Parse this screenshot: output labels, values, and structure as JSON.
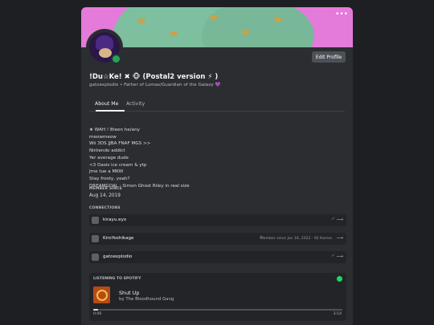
{
  "profile": {
    "display_name": "!Du☆Ke! ✖ 🐵 (Postal2 version ⚡ )",
    "subline": "gatoexplodio • Father of Lumas/Guardian of the Galaxy 💜",
    "edit_button": "Edit Profile",
    "status": "online",
    "banner_color": "#e47ad9",
    "status_color": "#23a559"
  },
  "tabs": [
    {
      "label": "About Me",
      "active": true
    },
    {
      "label": "Activity",
      "active": false
    }
  ],
  "bio_lines": "★ WAH ! 8teen he/any\nmeowmeow\nWii 3DS JJBA FNAF MGS >>\nNintendo addict\nYer average dude\n<3 Oasis ice cream & ytp\nJme tue a MKW\nStay frosty, yeah?\nDREAMGOAL : Simon Ghost Riley in real size",
  "member_since": {
    "heading": "MEMBER SINCE",
    "value": "Aug 14, 2019"
  },
  "connections": {
    "heading": "CONNECTIONS",
    "items": [
      {
        "name": "kirayu.eyx",
        "meta": "",
        "icon": "twitch-icon"
      },
      {
        "name": "KiroYoshikage",
        "meta": "Member since Jan 16, 2022 · 92 Karma",
        "icon": "reddit-icon"
      },
      {
        "name": "gatoexplodio",
        "meta": "",
        "icon": "steam-icon"
      }
    ]
  },
  "spotify": {
    "heading": "LISTENING TO SPOTIFY",
    "song": "Shut Up",
    "artist": "by The Bloodhound Gang",
    "elapsed": "0:00",
    "duration": "3:14",
    "progress": 0.02
  }
}
